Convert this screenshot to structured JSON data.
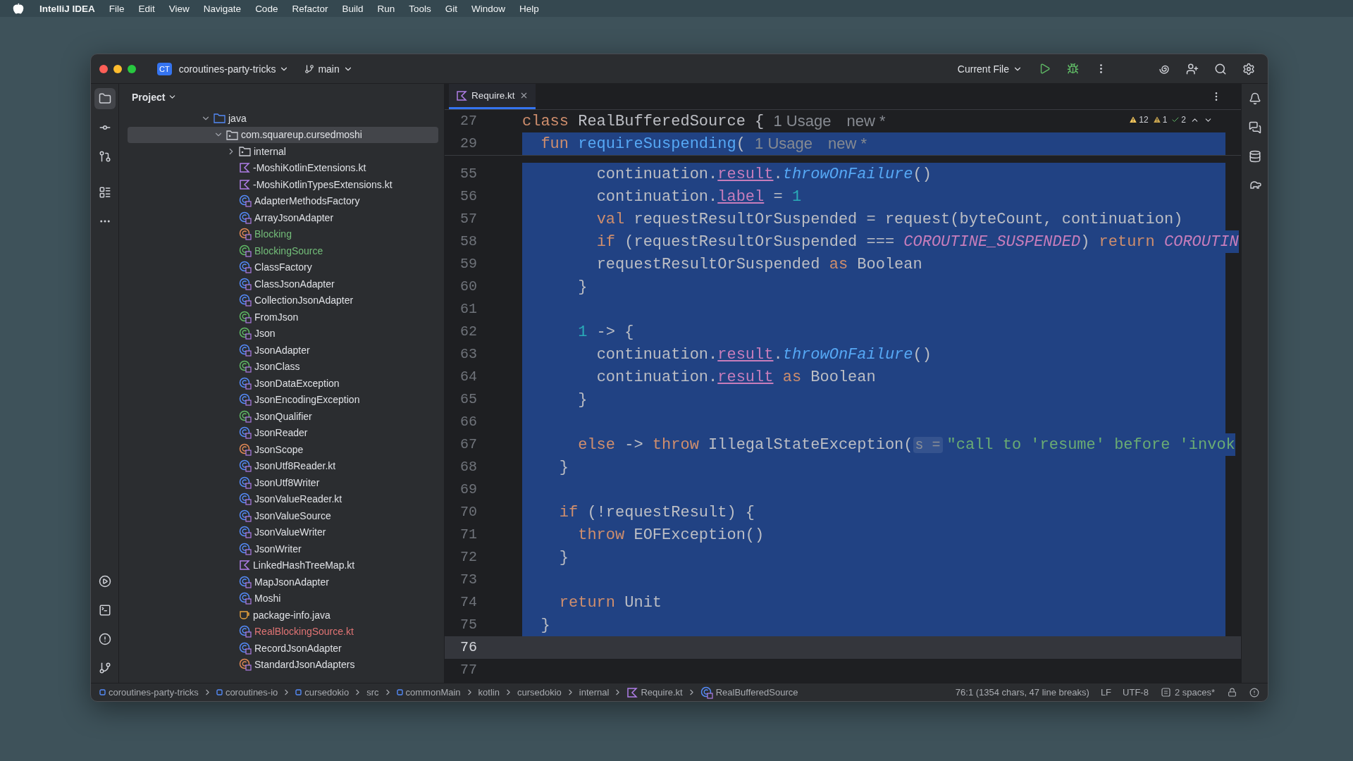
{
  "menubar": {
    "app": "IntelliJ IDEA",
    "menus": [
      "File",
      "Edit",
      "View",
      "Navigate",
      "Code",
      "Refactor",
      "Build",
      "Run",
      "Tools",
      "Git",
      "Window",
      "Help"
    ]
  },
  "toolbar": {
    "project_badge": "CT",
    "project": "coroutines-party-tricks",
    "branch": "main",
    "run_config": "Current File"
  },
  "project_panel": {
    "title": "Project",
    "tree": [
      {
        "label": "java",
        "kind": "source-folder",
        "added": false,
        "error": false,
        "expanded": true,
        "selected": false,
        "children": [
          {
            "label": "com.squareup.cursedmoshi",
            "kind": "package",
            "added": false,
            "error": false,
            "expanded": true,
            "selected": true,
            "children": [
              {
                "label": "internal",
                "kind": "package",
                "added": false,
                "error": false,
                "expanded": false,
                "selected": false
              },
              {
                "label": "-MoshiKotlinExtensions.kt",
                "kind": "kotlin-file",
                "added": false,
                "error": false,
                "selected": false
              },
              {
                "label": "-MoshiKotlinTypesExtensions.kt",
                "kind": "kotlin-file",
                "added": false,
                "error": false,
                "selected": false
              },
              {
                "label": "AdapterMethodsFactory",
                "kind": "class",
                "added": false,
                "error": false,
                "selected": false
              },
              {
                "label": "ArrayJsonAdapter",
                "kind": "class",
                "added": false,
                "error": false,
                "selected": false
              },
              {
                "label": "Blocking",
                "kind": "object",
                "added": true,
                "error": false,
                "selected": false
              },
              {
                "label": "BlockingSource",
                "kind": "interface",
                "added": true,
                "error": false,
                "selected": false
              },
              {
                "label": "ClassFactory",
                "kind": "class",
                "added": false,
                "error": false,
                "selected": false
              },
              {
                "label": "ClassJsonAdapter",
                "kind": "class",
                "added": false,
                "error": false,
                "selected": false
              },
              {
                "label": "CollectionJsonAdapter",
                "kind": "class",
                "added": false,
                "error": false,
                "selected": false
              },
              {
                "label": "FromJson",
                "kind": "annotation",
                "added": false,
                "error": false,
                "selected": false
              },
              {
                "label": "Json",
                "kind": "annotation",
                "added": false,
                "error": false,
                "selected": false
              },
              {
                "label": "JsonAdapter",
                "kind": "class",
                "added": false,
                "error": false,
                "selected": false
              },
              {
                "label": "JsonClass",
                "kind": "annotation",
                "added": false,
                "error": false,
                "selected": false
              },
              {
                "label": "JsonDataException",
                "kind": "class",
                "added": false,
                "error": false,
                "selected": false
              },
              {
                "label": "JsonEncodingException",
                "kind": "class",
                "added": false,
                "error": false,
                "selected": false
              },
              {
                "label": "JsonQualifier",
                "kind": "annotation",
                "added": false,
                "error": false,
                "selected": false
              },
              {
                "label": "JsonReader",
                "kind": "class",
                "added": false,
                "error": false,
                "selected": false
              },
              {
                "label": "JsonScope",
                "kind": "object",
                "added": false,
                "error": false,
                "selected": false
              },
              {
                "label": "JsonUtf8Reader.kt",
                "kind": "class",
                "added": false,
                "error": false,
                "selected": false
              },
              {
                "label": "JsonUtf8Writer",
                "kind": "class",
                "added": false,
                "error": false,
                "selected": false
              },
              {
                "label": "JsonValueReader.kt",
                "kind": "class",
                "added": false,
                "error": false,
                "selected": false
              },
              {
                "label": "JsonValueSource",
                "kind": "class",
                "added": false,
                "error": false,
                "selected": false
              },
              {
                "label": "JsonValueWriter",
                "kind": "class",
                "added": false,
                "error": false,
                "selected": false
              },
              {
                "label": "JsonWriter",
                "kind": "class",
                "added": false,
                "error": false,
                "selected": false
              },
              {
                "label": "LinkedHashTreeMap.kt",
                "kind": "kotlin-file",
                "added": false,
                "error": false,
                "selected": false
              },
              {
                "label": "MapJsonAdapter",
                "kind": "class",
                "added": false,
                "error": false,
                "selected": false
              },
              {
                "label": "Moshi",
                "kind": "class",
                "added": false,
                "error": false,
                "selected": false
              },
              {
                "label": "package-info.java",
                "kind": "java-file",
                "added": false,
                "error": false,
                "selected": false
              },
              {
                "label": "RealBlockingSource.kt",
                "kind": "class",
                "added": false,
                "error": true,
                "selected": false
              },
              {
                "label": "RecordJsonAdapter",
                "kind": "class",
                "added": false,
                "error": false,
                "selected": false
              },
              {
                "label": "StandardJsonAdapters",
                "kind": "object",
                "added": false,
                "error": false,
                "selected": false
              }
            ]
          }
        ]
      }
    ]
  },
  "editor": {
    "tab": {
      "label": "Require.kt",
      "selected": true
    },
    "inspections": {
      "warnings": "12",
      "weak_warnings": "1",
      "passed": "2"
    },
    "sticky_lines": [
      {
        "number": "27",
        "selected": false,
        "tokens": [
          {
            "kind": "kw",
            "text": "class "
          },
          {
            "kind": "plain",
            "text": "RealBufferedSource { "
          },
          {
            "kind": "inlay",
            "text": "1 Usage"
          },
          {
            "kind": "inlay",
            "text": "new *"
          }
        ]
      },
      {
        "number": "29",
        "selected": true,
        "tokens": [
          {
            "kind": "kw",
            "text": "  fun "
          },
          {
            "kind": "decl",
            "text": "requireSuspending"
          },
          {
            "kind": "plain",
            "text": "( "
          },
          {
            "kind": "inlay",
            "text": "1 Usage"
          },
          {
            "kind": "inlay",
            "text": "new *"
          }
        ]
      }
    ],
    "lines": [
      {
        "number": "55",
        "selected": true,
        "current": false,
        "tokens": [
          {
            "kind": "plain",
            "text": "        continuation."
          },
          {
            "kind": "prop",
            "text": "result"
          },
          {
            "kind": "plain",
            "text": "."
          },
          {
            "kind": "ext",
            "text": "throwOnFailure"
          },
          {
            "kind": "plain",
            "text": "()"
          }
        ]
      },
      {
        "number": "56",
        "selected": true,
        "current": false,
        "tokens": [
          {
            "kind": "plain",
            "text": "        continuation."
          },
          {
            "kind": "prop",
            "text": "label"
          },
          {
            "kind": "plain",
            "text": " = "
          },
          {
            "kind": "num",
            "text": "1"
          }
        ]
      },
      {
        "number": "57",
        "selected": true,
        "current": false,
        "tokens": [
          {
            "kind": "kw",
            "text": "        val "
          },
          {
            "kind": "plain",
            "text": "requestResultOrSuspended = request(byteCount, continuation)"
          }
        ]
      },
      {
        "number": "58",
        "selected": true,
        "current": false,
        "tokens": [
          {
            "kind": "kw",
            "text": "        if "
          },
          {
            "kind": "plain",
            "text": "(requestResultOrSuspended === "
          },
          {
            "kind": "const",
            "text": "COROUTINE_SUSPENDED"
          },
          {
            "kind": "plain",
            "text": ") "
          },
          {
            "kind": "kw",
            "text": "return "
          },
          {
            "kind": "const",
            "text": "COROUTIN"
          }
        ]
      },
      {
        "number": "59",
        "selected": true,
        "current": false,
        "tokens": [
          {
            "kind": "plain",
            "text": "        requestResultOrSuspended "
          },
          {
            "kind": "kw",
            "text": "as "
          },
          {
            "kind": "plain",
            "text": "Boolean"
          }
        ]
      },
      {
        "number": "60",
        "selected": true,
        "current": false,
        "tokens": [
          {
            "kind": "plain",
            "text": "      }"
          }
        ]
      },
      {
        "number": "61",
        "selected": true,
        "current": false
      },
      {
        "number": "62",
        "selected": true,
        "current": false,
        "tokens": [
          {
            "kind": "num",
            "text": "      1"
          },
          {
            "kind": "plain",
            "text": " -> {"
          }
        ]
      },
      {
        "number": "63",
        "selected": true,
        "current": false,
        "tokens": [
          {
            "kind": "plain",
            "text": "        continuation."
          },
          {
            "kind": "prop",
            "text": "result"
          },
          {
            "kind": "plain",
            "text": "."
          },
          {
            "kind": "ext",
            "text": "throwOnFailure"
          },
          {
            "kind": "plain",
            "text": "()"
          }
        ]
      },
      {
        "number": "64",
        "selected": true,
        "current": false,
        "tokens": [
          {
            "kind": "plain",
            "text": "        continuation."
          },
          {
            "kind": "prop",
            "text": "result"
          },
          {
            "kind": "kw",
            "text": " as "
          },
          {
            "kind": "plain",
            "text": "Boolean"
          }
        ]
      },
      {
        "number": "65",
        "selected": true,
        "current": false,
        "tokens": [
          {
            "kind": "plain",
            "text": "      }"
          }
        ]
      },
      {
        "number": "66",
        "selected": true,
        "current": false
      },
      {
        "number": "67",
        "selected": true,
        "current": false,
        "tokens": [
          {
            "kind": "kw",
            "text": "      else "
          },
          {
            "kind": "plain",
            "text": "-> "
          },
          {
            "kind": "kw",
            "text": "throw "
          },
          {
            "kind": "plain",
            "text": "IllegalStateException("
          },
          {
            "kind": "hint",
            "text": "s ="
          },
          {
            "kind": "str",
            "text": "\"call to 'resume' before 'invok"
          }
        ]
      },
      {
        "number": "68",
        "selected": true,
        "current": false,
        "tokens": [
          {
            "kind": "plain",
            "text": "    }"
          }
        ]
      },
      {
        "number": "69",
        "selected": true,
        "current": false
      },
      {
        "number": "70",
        "selected": true,
        "current": false,
        "tokens": [
          {
            "kind": "kw",
            "text": "    if "
          },
          {
            "kind": "plain",
            "text": "(!requestResult) {"
          }
        ]
      },
      {
        "number": "71",
        "selected": true,
        "current": false,
        "tokens": [
          {
            "kind": "kw",
            "text": "      throw "
          },
          {
            "kind": "plain",
            "text": "EOFException()"
          }
        ]
      },
      {
        "number": "72",
        "selected": true,
        "current": false,
        "tokens": [
          {
            "kind": "plain",
            "text": "    }"
          }
        ]
      },
      {
        "number": "73",
        "selected": true,
        "current": false
      },
      {
        "number": "74",
        "selected": true,
        "current": false,
        "tokens": [
          {
            "kind": "kw",
            "text": "    return "
          },
          {
            "kind": "plain",
            "text": "Unit"
          }
        ]
      },
      {
        "number": "75",
        "selected": true,
        "current": false,
        "tokens": [
          {
            "kind": "plain",
            "text": "  }"
          }
        ]
      },
      {
        "number": "76",
        "selected": false,
        "current": true
      },
      {
        "number": "77",
        "selected": false,
        "current": false
      }
    ]
  },
  "status_bar": {
    "breadcrumbs": [
      {
        "label": "coroutines-party-tricks",
        "kind": "module"
      },
      {
        "label": "coroutines-io",
        "kind": "module"
      },
      {
        "label": "cursedokio",
        "kind": "module"
      },
      {
        "label": "src",
        "kind": "plain"
      },
      {
        "label": "commonMain",
        "kind": "module"
      },
      {
        "label": "kotlin",
        "kind": "plain"
      },
      {
        "label": "cursedokio",
        "kind": "plain"
      },
      {
        "label": "internal",
        "kind": "plain"
      },
      {
        "label": "Require.kt",
        "kind": "kotlin-file"
      },
      {
        "label": "RealBufferedSource",
        "kind": "class"
      }
    ],
    "position": "76:1 (1354 chars, 47 line breaks)",
    "line_separator": "LF",
    "encoding": "UTF-8",
    "indent": "2 spaces*"
  }
}
